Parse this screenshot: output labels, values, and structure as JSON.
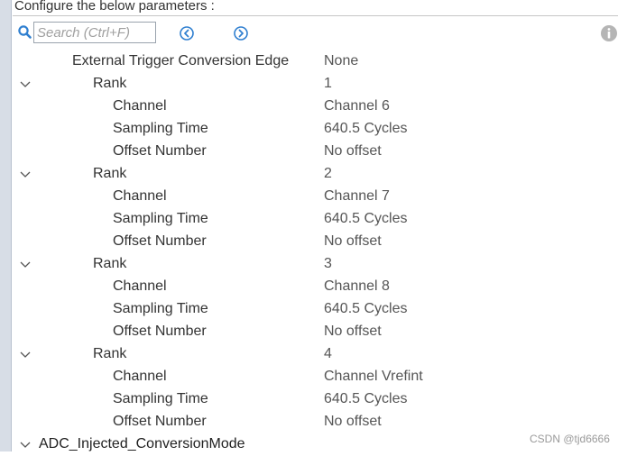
{
  "header": {
    "title": "Configure the below parameters :"
  },
  "toolbar": {
    "search_placeholder": "Search (Ctrl+F)",
    "search_icon": "search-icon",
    "prev_icon": "circle-arrow-left-icon",
    "next_icon": "circle-arrow-right-icon",
    "info_icon": "info-icon"
  },
  "params": {
    "trigger_edge": {
      "label": "External Trigger Conversion Edge",
      "value": "None"
    },
    "ranks": [
      {
        "label": "Rank",
        "value": "1",
        "channel_label": "Channel",
        "channel": "Channel 6",
        "sampling_label": "Sampling Time",
        "sampling": "640.5 Cycles",
        "offset_label": "Offset Number",
        "offset": "No offset"
      },
      {
        "label": "Rank",
        "value": "2",
        "channel_label": "Channel",
        "channel": "Channel 7",
        "sampling_label": "Sampling Time",
        "sampling": "640.5 Cycles",
        "offset_label": "Offset Number",
        "offset": "No offset"
      },
      {
        "label": "Rank",
        "value": "3",
        "channel_label": "Channel",
        "channel": "Channel 8",
        "sampling_label": "Sampling Time",
        "sampling": "640.5 Cycles",
        "offset_label": "Offset Number",
        "offset": "No offset"
      },
      {
        "label": "Rank",
        "value": "4",
        "channel_label": "Channel",
        "channel": "Channel Vrefint",
        "sampling_label": "Sampling Time",
        "sampling": "640.5 Cycles",
        "offset_label": "Offset Number",
        "offset": "No offset"
      }
    ],
    "injected_section": {
      "label": "ADC_Injected_ConversionMode"
    }
  },
  "watermark": "CSDN @tjd6666",
  "colors": {
    "accent": "#2f7fd0",
    "rail": "#d7dde6",
    "info": "#b5b5b5"
  }
}
